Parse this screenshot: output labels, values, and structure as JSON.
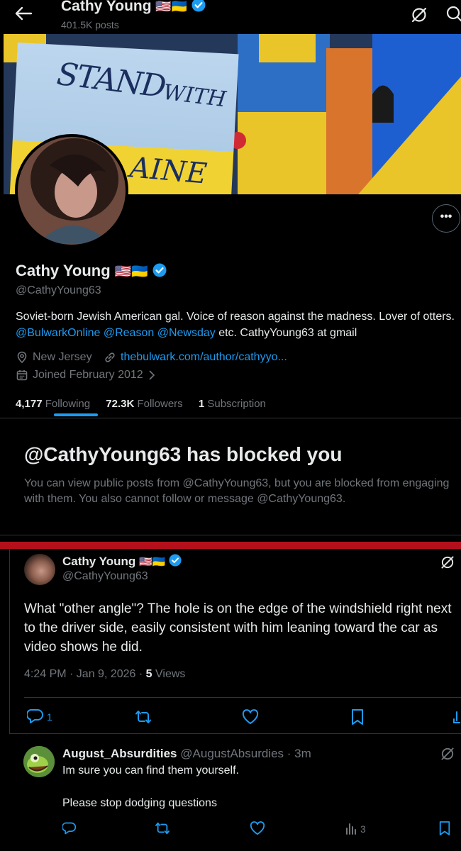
{
  "topbar": {
    "name": "Cathy Young",
    "flags": "🇺🇸🇺🇦",
    "posts": "401.5K posts"
  },
  "banner": {
    "sign_line1": "STAND",
    "sign_line2": "WITH",
    "sign_line3": "AINE"
  },
  "profile": {
    "display_name": "Cathy Young",
    "flags": "🇺🇸🇺🇦",
    "handle": "@CathyYoung63",
    "bio_text1": "Soviet-born Jewish American gal. Voice of reason against the madness. Lover of otters. ",
    "bio_link1": "@BulwarkOnline",
    "bio_link2": "@Reason",
    "bio_link3": "@Newsday",
    "bio_text2": " etc. CathyYoung63 at gmail",
    "location": "New Jersey",
    "website": "thebulwark.com/author/cathyyo...",
    "joined": "Joined February 2012",
    "following_count": "4,177",
    "following_label": "Following",
    "followers_count": "72.3K",
    "followers_label": "Followers",
    "subscription_count": "1",
    "subscription_label": "Subscription"
  },
  "blocked": {
    "title": "@CathyYoung63 has blocked you",
    "description": "You can view public posts from @CathyYoung63, but you are blocked from engaging with them. You also cannot follow or message @CathyYoung63."
  },
  "tweet": {
    "name": "Cathy Young",
    "flags": "🇺🇸🇺🇦",
    "handle": "@CathyYoung63",
    "line1": "What \"other angle\"? The hole is on the edge of the windshield right next",
    "line2": "to the driver side, easily consistent with him leaning toward the car as",
    "line3": "video shows he did.",
    "time": "4:24 PM · Jan 9, 2026 · ",
    "views_count": "5",
    "views_label": " Views",
    "reply_count": "1"
  },
  "reply": {
    "name": "August_Absurdities",
    "handle": "@AugustAbsurdies",
    "age": " · 3m",
    "line1": "Im sure you can find them yourself.",
    "line2": "Please stop dodging questions",
    "views": "3"
  },
  "colors": {
    "accent": "#1d9bf0",
    "muted": "#71767b",
    "divider": "#2f3336",
    "red_bar": "#b3101c"
  }
}
